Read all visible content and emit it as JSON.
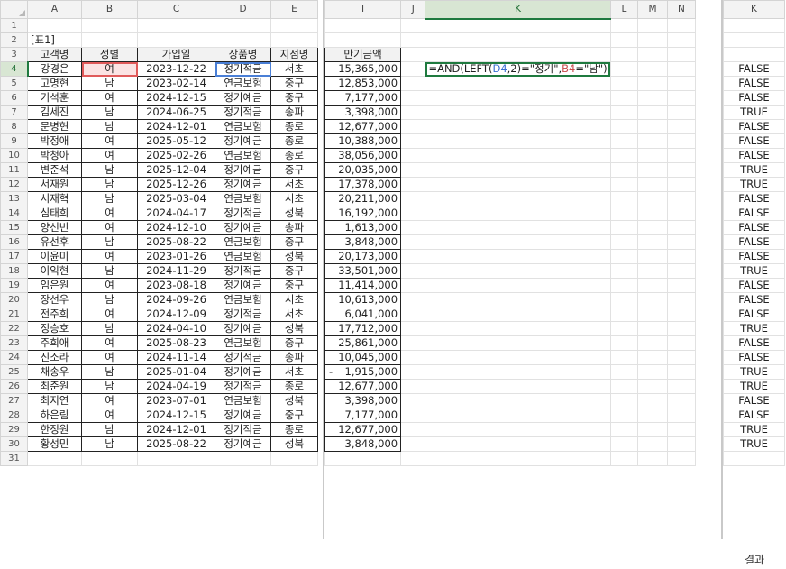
{
  "columns_left": [
    "A",
    "B",
    "C",
    "D",
    "E"
  ],
  "columns_mid": [
    "I",
    "J",
    "K",
    "L",
    "M",
    "N"
  ],
  "columns_right": [
    "K"
  ],
  "row_numbers": [
    "1",
    "2",
    "3",
    "4",
    "5",
    "6",
    "7",
    "8",
    "9",
    "10",
    "11",
    "12",
    "13",
    "14",
    "15",
    "16",
    "17",
    "18",
    "19",
    "20",
    "21",
    "22",
    "23",
    "24",
    "25",
    "26",
    "27",
    "28",
    "29",
    "30",
    "31"
  ],
  "table_title": "[표1]",
  "headers": {
    "name": "고객명",
    "gender": "성별",
    "join_date": "가입일",
    "product": "상품명",
    "branch": "지점명",
    "amount": "만기금액"
  },
  "rows": [
    [
      "강경은",
      "여",
      "2023-12-22",
      "정기적금",
      "서초",
      "15,365,000",
      "FALSE"
    ],
    [
      "고명현",
      "남",
      "2023-02-14",
      "연금보험",
      "중구",
      "12,853,000",
      "FALSE"
    ],
    [
      "기석훈",
      "여",
      "2024-12-15",
      "정기예금",
      "중구",
      "7,177,000",
      "FALSE"
    ],
    [
      "김세진",
      "남",
      "2024-06-25",
      "정기적금",
      "송파",
      "3,398,000",
      "TRUE"
    ],
    [
      "문병현",
      "남",
      "2024-12-01",
      "연금보험",
      "종로",
      "12,677,000",
      "FALSE"
    ],
    [
      "박정애",
      "여",
      "2025-05-12",
      "정기예금",
      "종로",
      "10,388,000",
      "FALSE"
    ],
    [
      "박청아",
      "여",
      "2025-02-26",
      "연금보험",
      "종로",
      "38,056,000",
      "FALSE"
    ],
    [
      "변준석",
      "남",
      "2025-12-04",
      "정기예금",
      "중구",
      "20,035,000",
      "TRUE"
    ],
    [
      "서재원",
      "남",
      "2025-12-26",
      "정기예금",
      "서초",
      "17,378,000",
      "TRUE"
    ],
    [
      "서재혁",
      "남",
      "2025-03-04",
      "연금보험",
      "서초",
      "20,211,000",
      "FALSE"
    ],
    [
      "심태희",
      "여",
      "2024-04-17",
      "정기적금",
      "성북",
      "16,192,000",
      "FALSE"
    ],
    [
      "양선빈",
      "여",
      "2024-12-10",
      "정기예금",
      "송파",
      "1,613,000",
      "FALSE"
    ],
    [
      "유선후",
      "남",
      "2025-08-22",
      "연금보험",
      "중구",
      "3,848,000",
      "FALSE"
    ],
    [
      "이윤미",
      "여",
      "2023-01-26",
      "연금보험",
      "성북",
      "20,173,000",
      "FALSE"
    ],
    [
      "이익현",
      "남",
      "2024-11-29",
      "정기적금",
      "중구",
      "33,501,000",
      "TRUE"
    ],
    [
      "임은원",
      "여",
      "2023-08-18",
      "정기예금",
      "중구",
      "11,414,000",
      "FALSE"
    ],
    [
      "장선우",
      "남",
      "2024-09-26",
      "연금보험",
      "서초",
      "10,613,000",
      "FALSE"
    ],
    [
      "전주희",
      "여",
      "2024-12-09",
      "정기적금",
      "서초",
      "6,041,000",
      "FALSE"
    ],
    [
      "정승호",
      "남",
      "2024-04-10",
      "정기예금",
      "성북",
      "17,712,000",
      "TRUE"
    ],
    [
      "주희애",
      "여",
      "2025-08-23",
      "연금보험",
      "중구",
      "25,861,000",
      "FALSE"
    ],
    [
      "진소라",
      "여",
      "2024-11-14",
      "정기적금",
      "송파",
      "10,045,000",
      "FALSE"
    ],
    [
      "채송우",
      "남",
      "2025-01-04",
      "정기예금",
      "서초",
      "1,915,000",
      "TRUE"
    ],
    [
      "최준원",
      "남",
      "2024-04-19",
      "정기적금",
      "종로",
      "12,677,000",
      "TRUE"
    ],
    [
      "최지연",
      "여",
      "2023-07-01",
      "연금보험",
      "성북",
      "3,398,000",
      "FALSE"
    ],
    [
      "하은림",
      "여",
      "2024-12-15",
      "정기예금",
      "중구",
      "7,177,000",
      "FALSE"
    ],
    [
      "한정원",
      "남",
      "2024-12-01",
      "정기적금",
      "종로",
      "12,677,000",
      "TRUE"
    ],
    [
      "황성민",
      "남",
      "2025-08-22",
      "정기예금",
      "성북",
      "3,848,000",
      "TRUE"
    ]
  ],
  "dash_prefix_row_index": 21,
  "dash_prefix": "-",
  "formula": {
    "part1": "=AND(LEFT(",
    "ref1": "D4",
    "part2": ",2)=\"정기\",",
    "ref2": "B4",
    "part3": "=\"남\")"
  },
  "caption": "결과",
  "colors": {
    "selected_header_bg": "#d8e6d3",
    "selected_header_text": "#1f6d33",
    "ref_blue": "#3b6fd1",
    "ref_red": "#c8494b"
  }
}
